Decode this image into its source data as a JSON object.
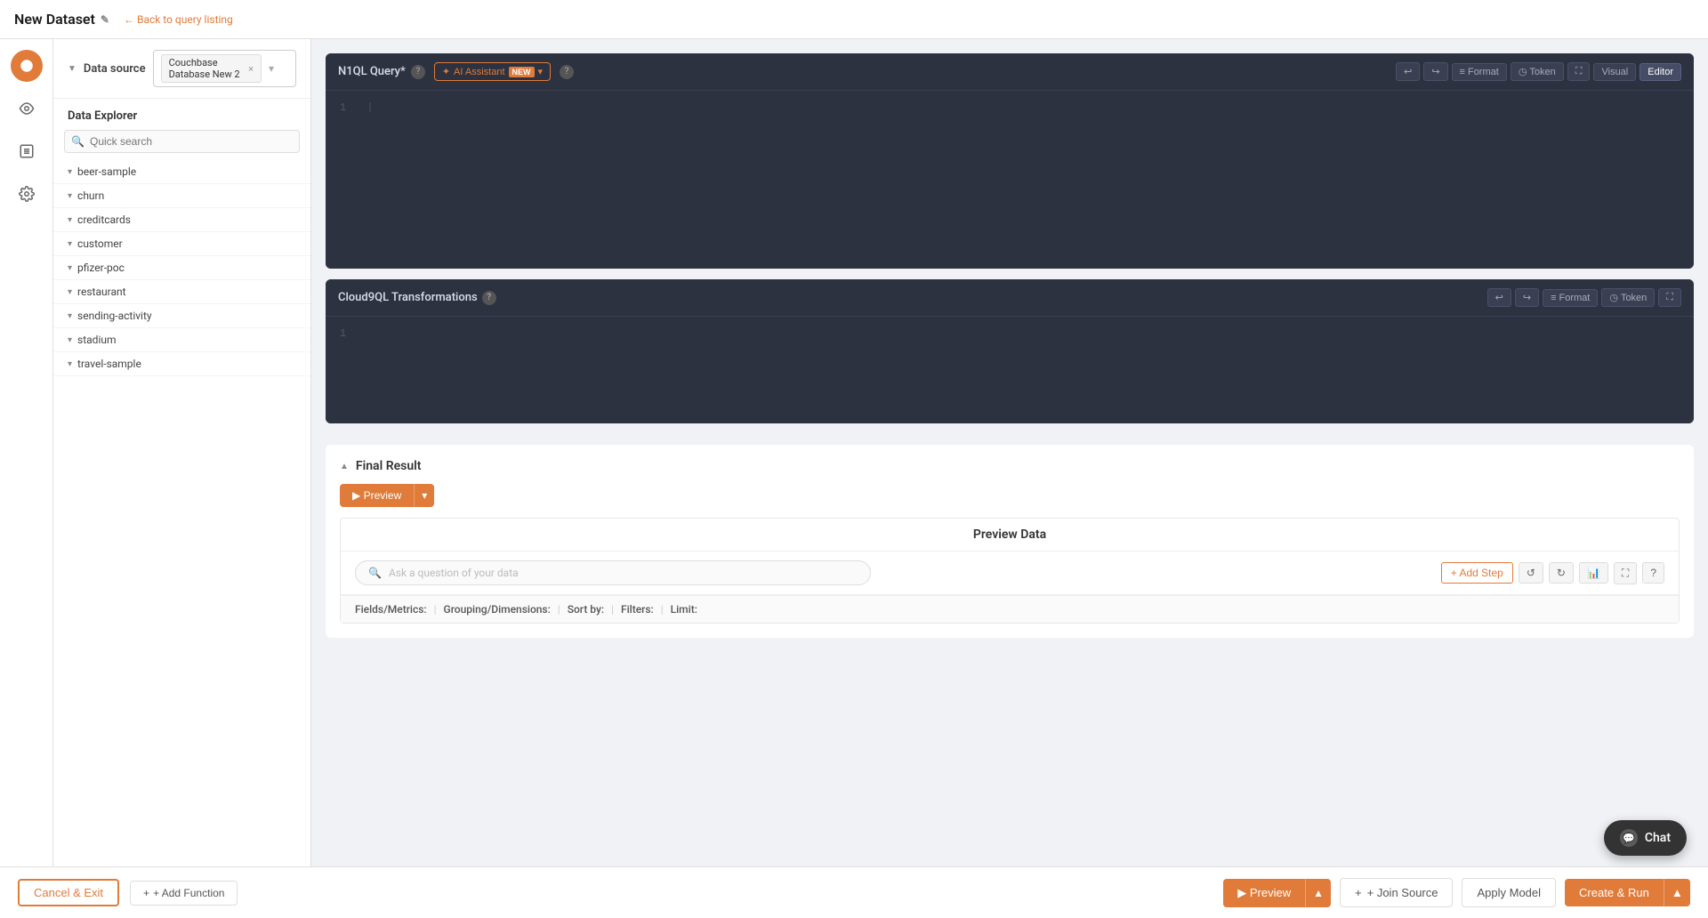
{
  "header": {
    "title": "New Dataset",
    "edit_icon": "✎",
    "back_label": "← Back to query listing"
  },
  "datasource": {
    "label": "Data source",
    "selected": "Couchbase Database New 2",
    "close": "×"
  },
  "data_explorer": {
    "title": "Data Explorer",
    "search_placeholder": "Quick search",
    "items": [
      {
        "name": "beer-sample"
      },
      {
        "name": "churn"
      },
      {
        "name": "creditcards"
      },
      {
        "name": "customer"
      },
      {
        "name": "pfizer-poc"
      },
      {
        "name": "restaurant"
      },
      {
        "name": "sending-activity"
      },
      {
        "name": "stadium"
      },
      {
        "name": "travel-sample"
      }
    ]
  },
  "query_editor": {
    "tab_label": "N1QL Query*",
    "help_tooltip": "?",
    "ai_assistant_label": "AI Assistant",
    "ai_new_badge": "NEW",
    "toolbar": {
      "undo": "↩",
      "redo": "↪",
      "format_label": "Format",
      "token_label": "Token",
      "expand_label": "⛶",
      "visual_label": "Visual",
      "editor_label": "Editor"
    },
    "line_number": "1"
  },
  "transform_editor": {
    "title": "Cloud9QL Transformations",
    "help_tooltip": "?",
    "toolbar": {
      "undo": "↩",
      "redo": "↪",
      "format_label": "Format",
      "token_label": "Token",
      "expand_label": "⛶"
    },
    "line_number": "1"
  },
  "final_result": {
    "title": "Final Result",
    "preview_btn": "▶ Preview",
    "preview_data_title": "Preview Data",
    "ask_placeholder": "Ask a question of your data",
    "add_step_label": "+ Add Step",
    "fields_label": "Fields/Metrics:",
    "grouping_label": "Grouping/Dimensions:",
    "sort_label": "Sort by:",
    "filters_label": "Filters:",
    "limit_label": "Limit:"
  },
  "bottom_bar": {
    "cancel_label": "Cancel & Exit",
    "add_function_label": "+ Add Function",
    "preview_label": "▶ Preview",
    "join_source_label": "+ Join Source",
    "apply_model_label": "Apply Model",
    "create_run_label": "Create & Run"
  },
  "chat": {
    "label": "Chat"
  }
}
